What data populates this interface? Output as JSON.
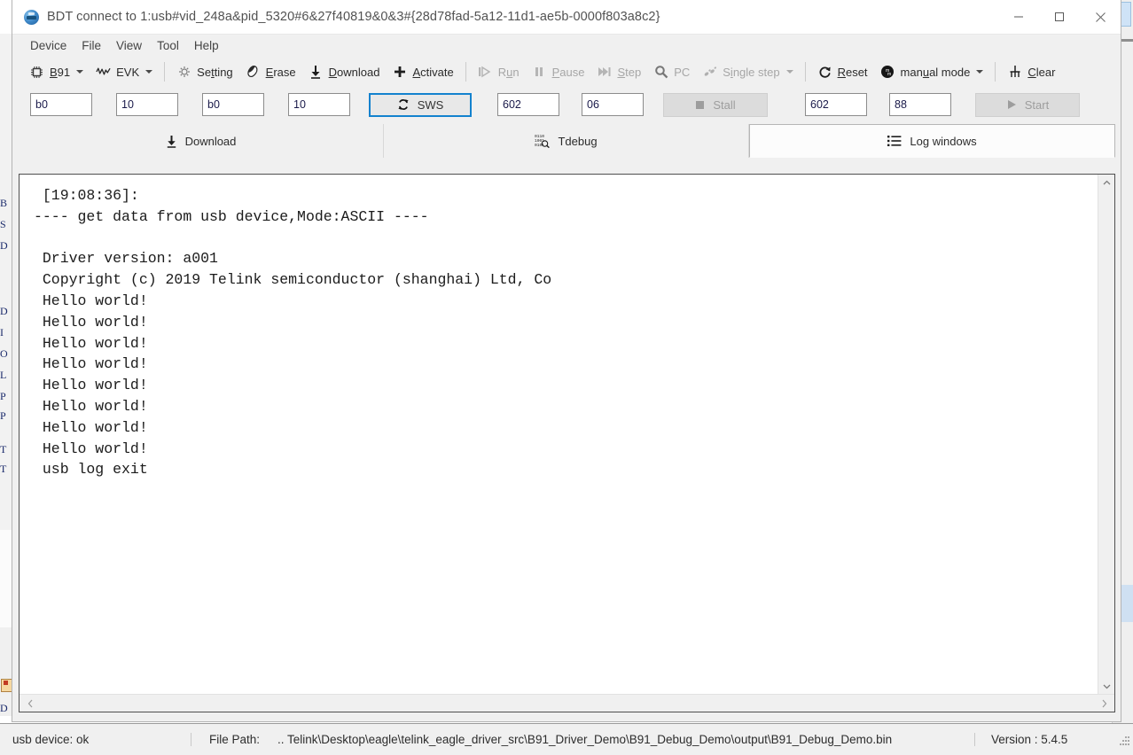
{
  "window": {
    "title": "BDT connect to 1:usb#vid_248a&pid_5320#6&27f40819&0&3#{28d78fad-5a12-11d1-ae5b-0000f803a8c2}",
    "app_icon": "bdt-globe-icon",
    "minimize_label": "Minimize",
    "maximize_label": "Maximize",
    "close_label": "Close"
  },
  "menu": {
    "items": [
      {
        "label": "Device"
      },
      {
        "label": "File"
      },
      {
        "label": "View"
      },
      {
        "label": "Tool"
      },
      {
        "label": "Help"
      }
    ]
  },
  "toolbar": {
    "chip": {
      "label": "B91",
      "icon": "chip-icon",
      "has_caret": true
    },
    "board": {
      "label": "EVK",
      "icon": "waveform-icon",
      "has_caret": true
    },
    "setting": {
      "label": "Setting",
      "icon": "gear-icon"
    },
    "erase": {
      "label": "Erase",
      "icon": "eraser-icon"
    },
    "download": {
      "label": "Download",
      "icon": "download-arrow-icon"
    },
    "activate": {
      "label": "Activate",
      "icon": "plus-icon"
    },
    "run": {
      "label": "Run",
      "icon": "play-outline-icon",
      "disabled": true
    },
    "pause": {
      "label": "Pause",
      "icon": "pause-icon",
      "disabled": true
    },
    "step": {
      "label": "Step",
      "icon": "step-forward-icon",
      "disabled": true
    },
    "pc": {
      "label": "PC",
      "icon": "magnifier-icon",
      "disabled": true
    },
    "single_step": {
      "label": "Single step",
      "icon": "footsteps-icon",
      "disabled": true,
      "has_caret": true
    },
    "reset": {
      "label": "Reset",
      "icon": "reset-circular-arrow-icon"
    },
    "mode": {
      "label": "manual mode",
      "icon": "mode-circle-icon",
      "has_caret": true
    },
    "clear": {
      "label": "Clear",
      "icon": "rake-icon"
    }
  },
  "fields": {
    "addr1": {
      "value": "b0",
      "placeholder": ""
    },
    "len1": {
      "value": "10",
      "placeholder": ""
    },
    "addr2": {
      "value": "b0",
      "placeholder": ""
    },
    "len2": {
      "value": "10",
      "placeholder": ""
    },
    "sws_button": {
      "label": "SWS",
      "icon": "refresh-icon",
      "focused": true
    },
    "field5": {
      "value": "602",
      "placeholder": ""
    },
    "field6": {
      "value": "06",
      "placeholder": ""
    },
    "stall_button": {
      "label": "Stall",
      "icon": "stop-square-icon",
      "disabled": true
    },
    "field7": {
      "value": "602",
      "placeholder": ""
    },
    "field8": {
      "value": "88",
      "placeholder": ""
    },
    "start_button": {
      "label": "Start",
      "icon": "play-icon",
      "disabled": true
    }
  },
  "tabs": [
    {
      "label": "Download",
      "icon": "download-arrow-icon",
      "active": false
    },
    {
      "label": "Tdebug",
      "icon": "binary-search-icon",
      "active": false
    },
    {
      "label": "Log windows",
      "icon": "list-lines-icon",
      "active": true
    }
  ],
  "log": {
    "content": " [19:08:36]:\n---- get data from usb device,Mode:ASCII ----\n\n Driver version: a001\n Copyright (c) 2019 Telink semiconductor (shanghai) Ltd, Co\n Hello world!\n Hello world!\n Hello world!\n Hello world!\n Hello world!\n Hello world!\n Hello world!\n Hello world!\n usb log exit",
    "lines": [
      " [19:08:36]:",
      "---- get data from usb device,Mode:ASCII ----",
      "",
      " Driver version: a001",
      " Copyright (c) 2019 Telink semiconductor (shanghai) Ltd, Co",
      " Hello world!",
      " Hello world!",
      " Hello world!",
      " Hello world!",
      " Hello world!",
      " Hello world!",
      " Hello world!",
      " Hello world!",
      " usb log exit"
    ],
    "scroll_up_icon": "chevron-up-icon",
    "scroll_down_icon": "chevron-down-icon",
    "scroll_left_icon": "chevron-left-icon",
    "scroll_right_icon": "chevron-right-icon"
  },
  "status_bar": {
    "device": "usb device: ok",
    "path_label": "File Path:",
    "path_value": ".. Telink\\Desktop\\eagle\\telink_eagle_driver_src\\B91_Driver_Demo\\B91_Debug_Demo\\output\\B91_Debug_Demo.bin",
    "version": "Version : 5.4.5"
  },
  "colors": {
    "accent": "#1382ce",
    "window_bg": "#f0f0f0",
    "log_bg": "#ffffff",
    "log_text": "#1b1b1b",
    "title_text": "#525252"
  }
}
